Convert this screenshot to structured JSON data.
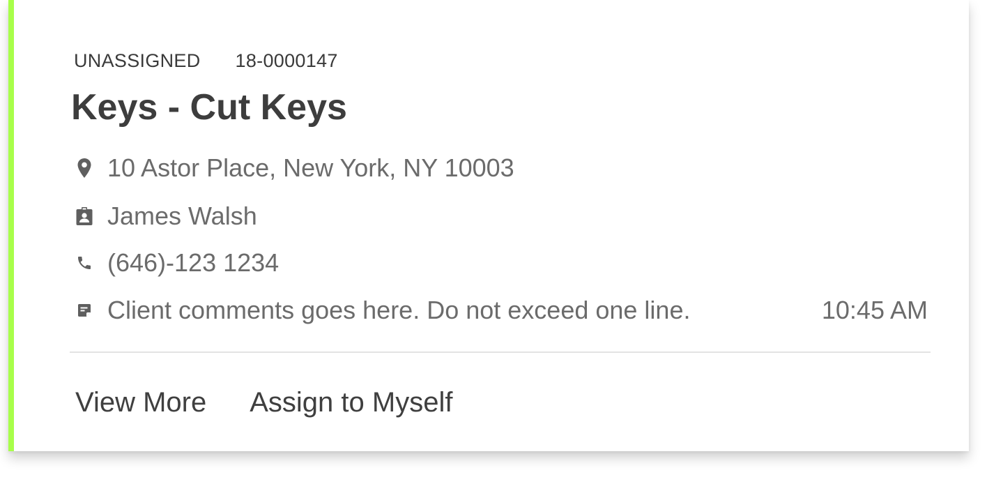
{
  "card": {
    "status": "UNASSIGNED",
    "ticket_id": "18-0000147",
    "title": "Keys - Cut Keys",
    "address": "10 Astor Place, New York, NY 10003",
    "contact_name": "James Walsh",
    "phone": "(646)-123 1234",
    "comment": "Client comments goes here. Do not exceed one line.",
    "time": "10:45 AM",
    "accent_color": "#a8ff4a",
    "icons": {
      "address": "location-pin-icon",
      "contact": "contact-badge-icon",
      "phone": "phone-icon",
      "comment": "note-icon"
    }
  },
  "actions": {
    "view_more_label": "View More",
    "assign_label": "Assign to Myself"
  }
}
